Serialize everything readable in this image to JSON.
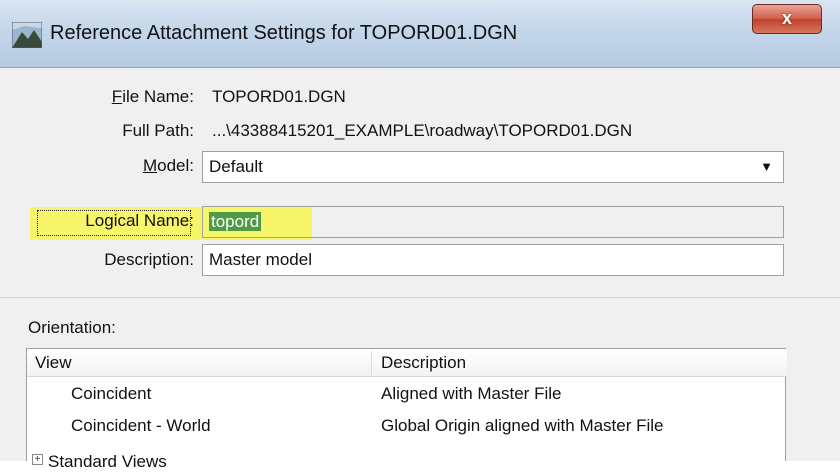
{
  "window": {
    "title": "Reference Attachment Settings for TOPORD01.DGN",
    "close_glyph": "x",
    "icon": "microstation-app-icon"
  },
  "form": {
    "file_name": {
      "label_u": "F",
      "label_rest": "ile Name:",
      "value": "TOPORD01.DGN"
    },
    "full_path": {
      "label": "Full Path:",
      "value": "...\\43388415201_EXAMPLE\\roadway\\TOPORD01.DGN"
    },
    "model": {
      "label_u": "M",
      "label_rest": "odel:",
      "value": "Default"
    },
    "logical_name": {
      "label_pre": "Lo",
      "label_u": "g",
      "label_rest": "ical Name:",
      "value": "topord"
    },
    "description": {
      "label": "Description:",
      "value": "Master model"
    }
  },
  "orientation": {
    "group_label": "Orientation:",
    "columns": [
      "View",
      "Description"
    ],
    "rows": [
      {
        "view": "Coincident",
        "description": "Aligned with Master File"
      },
      {
        "view": "Coincident - World",
        "description": "Global Origin aligned with Master File"
      }
    ],
    "partial_row": "Standard Views"
  },
  "colors": {
    "highlight": "#f7f56a",
    "selection": "#4f9a45",
    "close_button": "#c2402c"
  }
}
